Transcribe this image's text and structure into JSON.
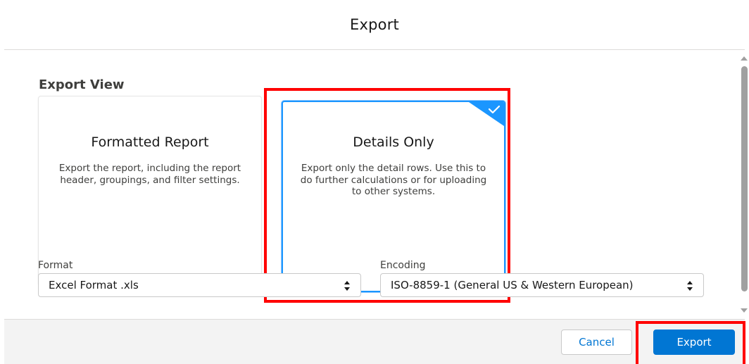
{
  "dialog": {
    "title": "Export"
  },
  "export_view": {
    "label": "Export View",
    "options": [
      {
        "title": "Formatted Report",
        "description": "Export the report, including the report header, groupings, and filter settings.",
        "selected": false
      },
      {
        "title": "Details Only",
        "description": "Export only the detail rows. Use this to do further calculations or for uploading to other systems.",
        "selected": true
      }
    ]
  },
  "format": {
    "label": "Format",
    "value": "Excel Format .xls"
  },
  "encoding": {
    "label": "Encoding",
    "value": "ISO-8859-1 (General US & Western European)"
  },
  "footer": {
    "cancel_label": "Cancel",
    "export_label": "Export"
  },
  "colors": {
    "brand": "#0176d3",
    "selection_border": "#1b96ff",
    "annotation_red": "#ff0000",
    "footer_bg": "#f3f3f3"
  }
}
